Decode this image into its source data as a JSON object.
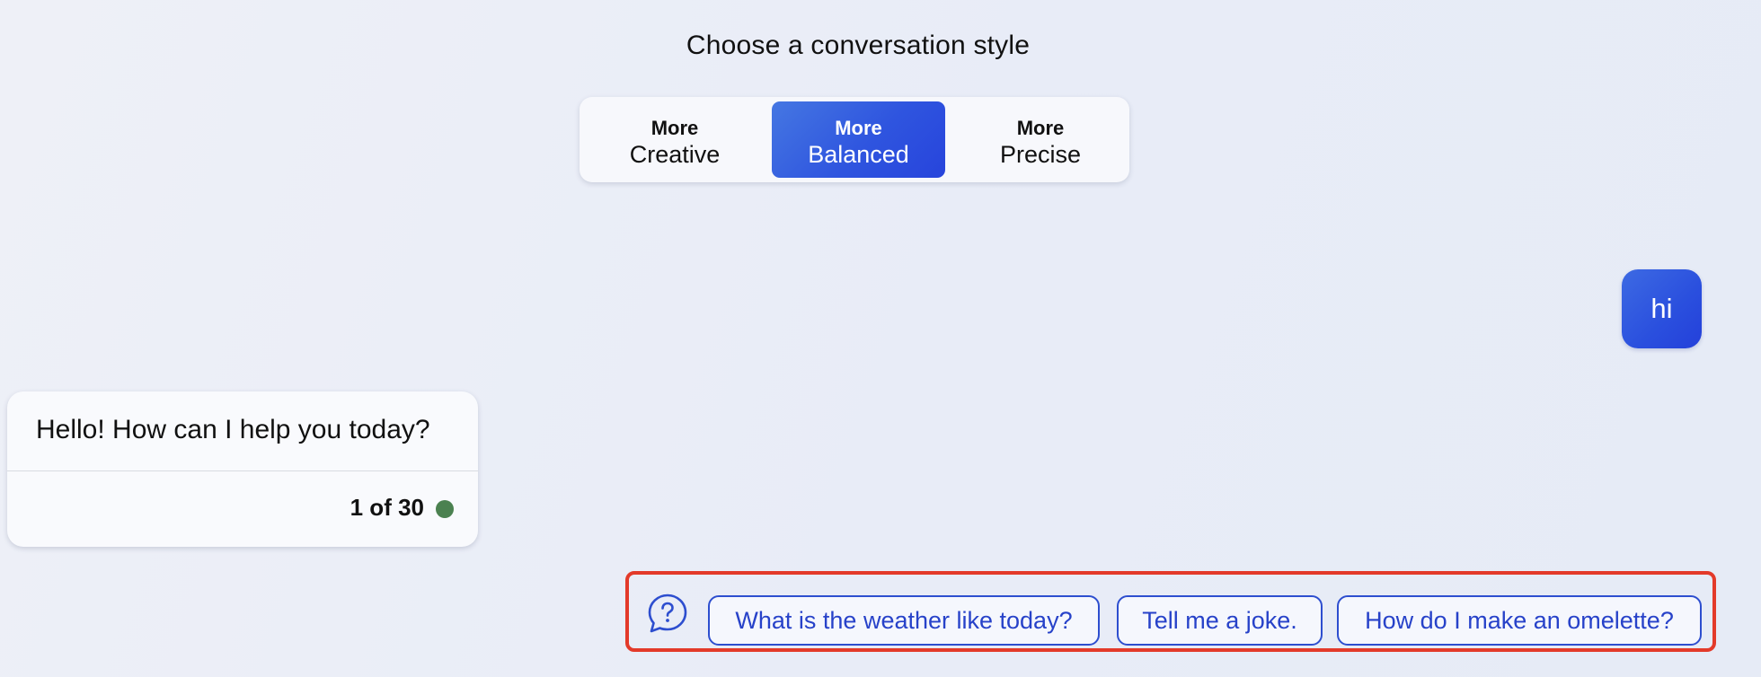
{
  "header": {
    "title": "Choose a conversation style"
  },
  "conversation_styles": [
    {
      "line1": "More",
      "line2": "Creative",
      "selected": false
    },
    {
      "line1": "More",
      "line2": "Balanced",
      "selected": true
    },
    {
      "line1": "More",
      "line2": "Precise",
      "selected": false
    }
  ],
  "messages": {
    "user": "hi",
    "bot": "Hello! How can I help you today?",
    "counter": "1 of 30"
  },
  "suggestions": {
    "icon": "question-bubble-icon",
    "items": [
      "What is the weather like today?",
      "Tell me a joke.",
      "How do I make an omelette?"
    ]
  },
  "colors": {
    "accent": "#2f55df",
    "status_dot": "#4b8150",
    "highlight_border": "#e33a2a",
    "chip_text": "#2742c9"
  }
}
